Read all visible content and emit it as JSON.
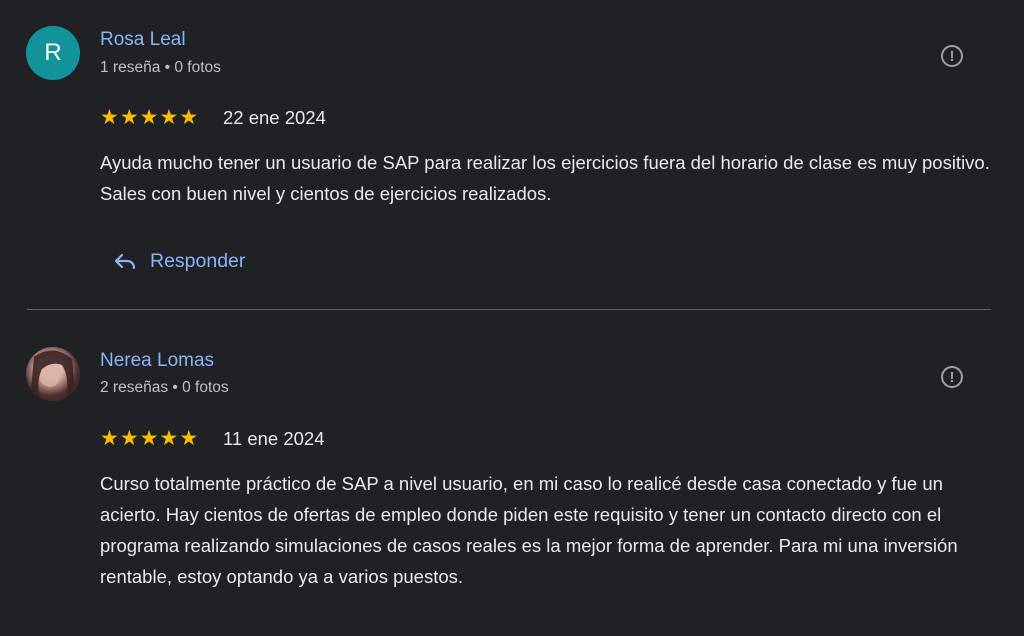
{
  "reviews": [
    {
      "avatar_letter": "R",
      "name": "Rosa Leal",
      "meta": "1 reseña • 0 fotos",
      "rating": 5,
      "stars": "★★★★★",
      "date": "22 ene 2024",
      "text": "Ayuda mucho tener un usuario de SAP para realizar los ejercicios fuera del horario de clase es muy positivo. Sales con buen nivel y cientos de ejercicios realizados.",
      "reply_label": "Responder",
      "flag_glyph": "!"
    },
    {
      "name": "Nerea Lomas",
      "meta": "2 reseñas • 0 fotos",
      "rating": 5,
      "stars": "★★★★★",
      "date": "11 ene 2024",
      "text": "Curso totalmente práctico de SAP a nivel usuario, en mi caso lo realicé desde casa conectado y fue un acierto. Hay cientos de ofertas de empleo donde piden este requisito y tener un contacto directo con el programa realizando simulaciones de casos reales es la mejor forma de aprender. Para mi una inversión rentable, estoy optando ya a varios puestos.",
      "flag_glyph": "!"
    }
  ],
  "colors": {
    "background": "#202124",
    "link": "#8ab4f8",
    "star": "#fbbc04",
    "avatar_teal": "#12939a"
  },
  "icons": {
    "flag": "report-flag-icon",
    "reply": "reply-arrow-icon",
    "star": "star-icon"
  }
}
